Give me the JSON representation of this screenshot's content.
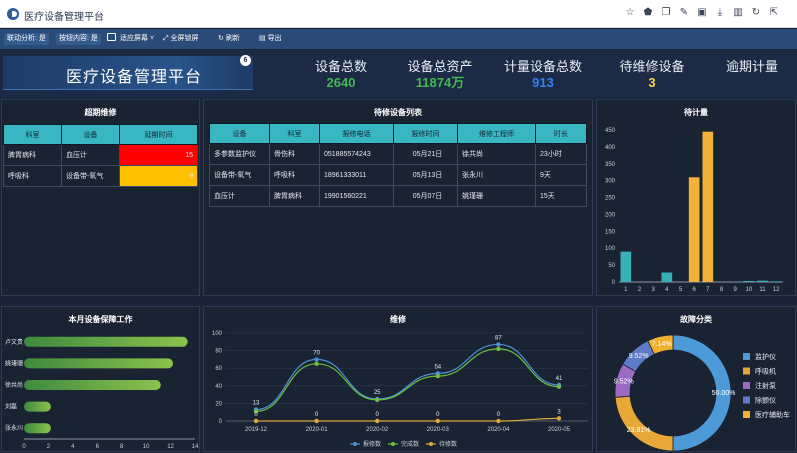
{
  "app": {
    "title": "医疗设备管理平台"
  },
  "browser_icons": [
    "star-icon",
    "tag-icon",
    "copy-icon",
    "edit-icon",
    "image-icon",
    "download-icon",
    "trash-icon",
    "refresh-icon",
    "external-link-icon"
  ],
  "toolbar": {
    "analysis": "联动分析: 是",
    "drill": "按钮内容: 是",
    "fit_screen": "适应屏幕",
    "fullscreen": "全屏锁屏",
    "refresh": "刷新",
    "export": "导出"
  },
  "header": {
    "title": "医疗设备管理平台",
    "bubble": "6",
    "stats": [
      {
        "label": "设备总数",
        "value": "2640",
        "color": "#3fb950"
      },
      {
        "label": "设备总资产",
        "value": "11874万",
        "color": "#3fb950"
      },
      {
        "label": "计量设备总数",
        "value": "913",
        "color": "#2f81f7"
      },
      {
        "label": "待维修设备",
        "value": "3",
        "color": "#f7d54a"
      },
      {
        "label": "逾期计量",
        "value": "",
        "color": "#ffffff"
      }
    ]
  },
  "overdue": {
    "title": "超期维修",
    "columns": [
      "科室",
      "设备",
      "延期时间"
    ],
    "rows": [
      {
        "dept": "脾胃病科",
        "device": "血压计",
        "days": "15",
        "color": "#ff0000"
      },
      {
        "dept": "呼吸科",
        "device": "设备带-氧气",
        "days": "9",
        "color": "#ffc000"
      }
    ]
  },
  "repair_list": {
    "title": "待修设备列表",
    "columns": [
      "设备",
      "科室",
      "报修电话",
      "报修时间",
      "维修工程师",
      "时长"
    ],
    "rows": [
      [
        "多参数监护仪",
        "骨伤科",
        "051885574243",
        "05月21日",
        "徐共尚",
        "23小时"
      ],
      [
        "设备带-氧气",
        "呼吸科",
        "18961333011",
        "05月13日",
        "张永川",
        "9天"
      ],
      [
        "血压计",
        "脾胃病科",
        "19901560221",
        "05月07日",
        "姚瑾珊",
        "15天"
      ]
    ]
  },
  "pending": {
    "title": "待计量",
    "chart_data": {
      "type": "bar",
      "categories": [
        "1",
        "2",
        "3",
        "4",
        "5",
        "6",
        "7",
        "8",
        "9",
        "10",
        "11",
        "12"
      ],
      "values": [
        90,
        0,
        0,
        28,
        0,
        310,
        445,
        0,
        0,
        3,
        4,
        2
      ],
      "colors": [
        "#39b0b8",
        "#39b0b8",
        "#39b0b8",
        "#39b0b8",
        "#f3b13a",
        "#f3b13a",
        "#f3b13a",
        "#39b0b8",
        "#39b0b8",
        "#39b0b8",
        "#39b0b8",
        "#39b0b8"
      ],
      "ylim": [
        0,
        450
      ],
      "yticks": [
        0,
        50,
        100,
        150,
        200,
        250,
        300,
        350,
        400,
        450
      ]
    }
  },
  "guarantee": {
    "title": "本月设备保障工作",
    "chart_data": {
      "type": "bar",
      "orientation": "horizontal",
      "categories": [
        "卢文贵",
        "姚瑾珊",
        "徐共尚",
        "刘磊",
        "张永川"
      ],
      "values": [
        13.4,
        12.2,
        11.2,
        2.2,
        2.2
      ],
      "xlim": [
        0,
        14
      ],
      "xticks": [
        0,
        2,
        4,
        6,
        8,
        10,
        12,
        14
      ]
    }
  },
  "maintenance": {
    "title": "维修",
    "chart_data": {
      "type": "line",
      "x": [
        "2019-12",
        "2020-01",
        "2020-02",
        "2020-03",
        "2020-04",
        "2020-05"
      ],
      "series": [
        {
          "name": "报修数",
          "values": [
            13,
            70,
            25,
            54,
            87,
            41
          ],
          "labels": [
            "13",
            "70",
            "25",
            "54",
            "87",
            "41"
          ],
          "color": "#4c8fd6"
        },
        {
          "name": "完成数",
          "values": [
            11,
            65,
            24,
            51,
            82,
            39
          ],
          "labels": [
            "",
            "",
            "",
            "",
            "",
            ""
          ],
          "color": "#6fbf3f"
        },
        {
          "name": "待修数",
          "values": [
            0,
            0,
            0,
            0,
            0,
            3
          ],
          "labels": [
            "0",
            "0",
            "0",
            "0",
            "0",
            "3"
          ],
          "color": "#e0a53c"
        }
      ],
      "ylim": [
        0,
        100
      ],
      "yticks": [
        0,
        20,
        40,
        60,
        80,
        100
      ]
    }
  },
  "faults": {
    "title": "故障分类",
    "chart_data": {
      "type": "pie",
      "labels": [
        "监护仪",
        "呼吸机",
        "注射泵",
        "除颤仪",
        "医疗辅助车"
      ],
      "values": [
        50.0,
        23.81,
        9.52,
        9.52,
        7.14
      ],
      "value_labels": [
        "50.00%",
        "23.81%",
        "9.52%",
        "9.52%",
        "7.14%"
      ],
      "colors": [
        "#4e9ad8",
        "#e8a838",
        "#9b6bc3",
        "#5e7bc8",
        "#f0b030"
      ]
    }
  }
}
